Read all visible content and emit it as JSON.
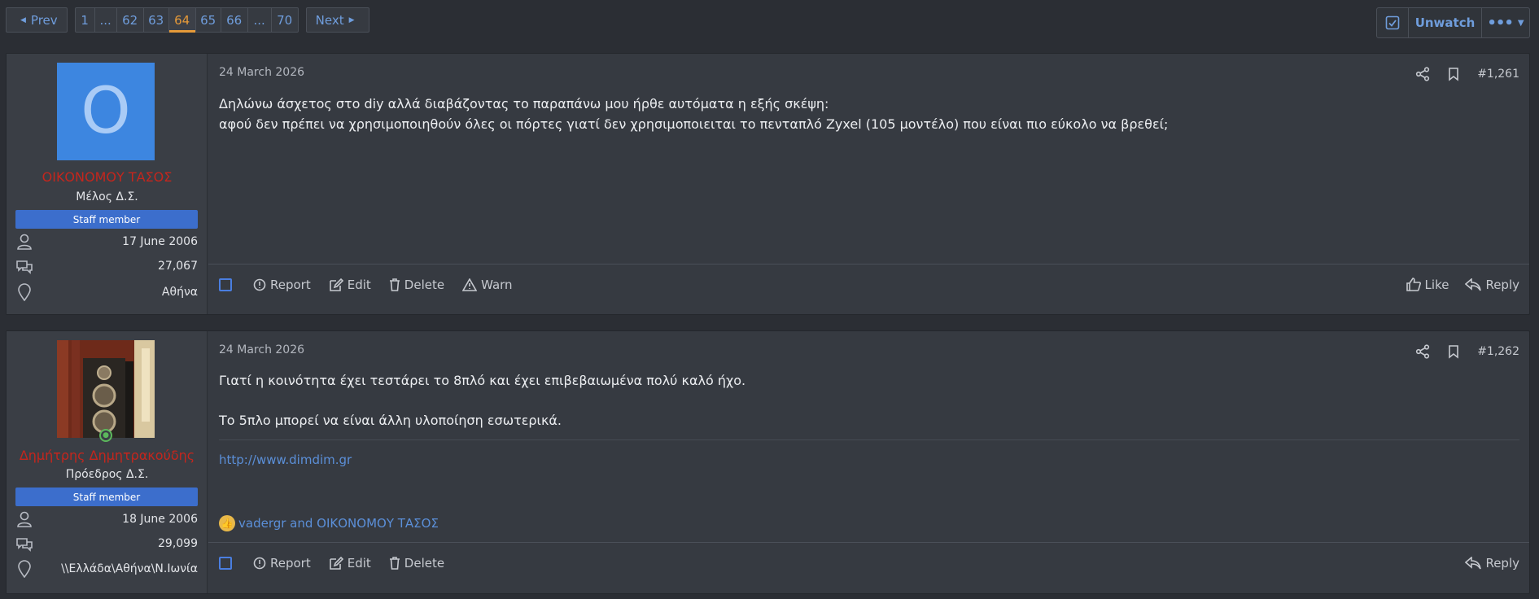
{
  "pagination": {
    "prev_label": "Prev",
    "next_label": "Next",
    "pages": [
      "1",
      "...",
      "62",
      "63",
      "64",
      "65",
      "66",
      "...",
      "70"
    ],
    "current": "64"
  },
  "thread_tools": {
    "unwatch_label": "Unwatch",
    "more_label": "•••"
  },
  "posts": [
    {
      "username": "ΟΙΚΟΝΟΜΟΥ ΤΑΣΟΣ",
      "avatar_letter": "O",
      "user_title": "Μέλος Δ.Σ.",
      "banner": "Staff member",
      "joined": "17 June 2006",
      "messages": "27,067",
      "location": "Αθήνα",
      "date": "24 March 2026",
      "number": "#1,261",
      "lines": [
        "Δηλώνω άσχετος στο diy αλλά διαβάζοντας το παραπάνω μου ήρθε αυτόματα η εξής σκέψη:",
        "αφού δεν πρέπει να χρησιμοποιηθούν όλες οι πόρτες γιατί δεν χρησιμοποιειται το πενταπλό Zyxel (105 μοντέλο) που είναι πιο εύκολο να βρεθεί;"
      ],
      "actions": {
        "report": "Report",
        "edit": "Edit",
        "delete": "Delete",
        "warn": "Warn",
        "like": "Like",
        "reply": "Reply"
      }
    },
    {
      "username": "Δημήτρης Δημητρακούδης",
      "user_title": "Πρόεδρος Δ.Σ.",
      "banner": "Staff member",
      "joined": "18 June 2006",
      "messages": "29,099",
      "location": "\\\\Ελλάδα\\Αθήνα\\Ν.Ιωνία",
      "date": "24 March 2026",
      "number": "#1,262",
      "lines": [
        "Γιατί η κοινότητα έχει τεστάρει το 8πλό και έχει επιβεβαιωμένα πολύ καλό ήχο.",
        "Το 5πλο μπορεί να είναι άλλη υλοποίηση εσωτερικά."
      ],
      "signature_link": "http://www.dimdim.gr",
      "likes_text": "vadergr and ΟΙΚΟΝΟΜΟΥ ΤΑΣΟΣ",
      "actions": {
        "report": "Report",
        "edit": "Edit",
        "delete": "Delete",
        "reply": "Reply"
      }
    }
  ],
  "colors": {
    "page_bg": "#2b2e34",
    "post_bg": "#363a41",
    "link": "#5b8fd8",
    "current_page": "#e69a39",
    "username": "#c4261d",
    "staff_banner": "#3c6ecc",
    "avatar_bg": "#3d86e0"
  }
}
